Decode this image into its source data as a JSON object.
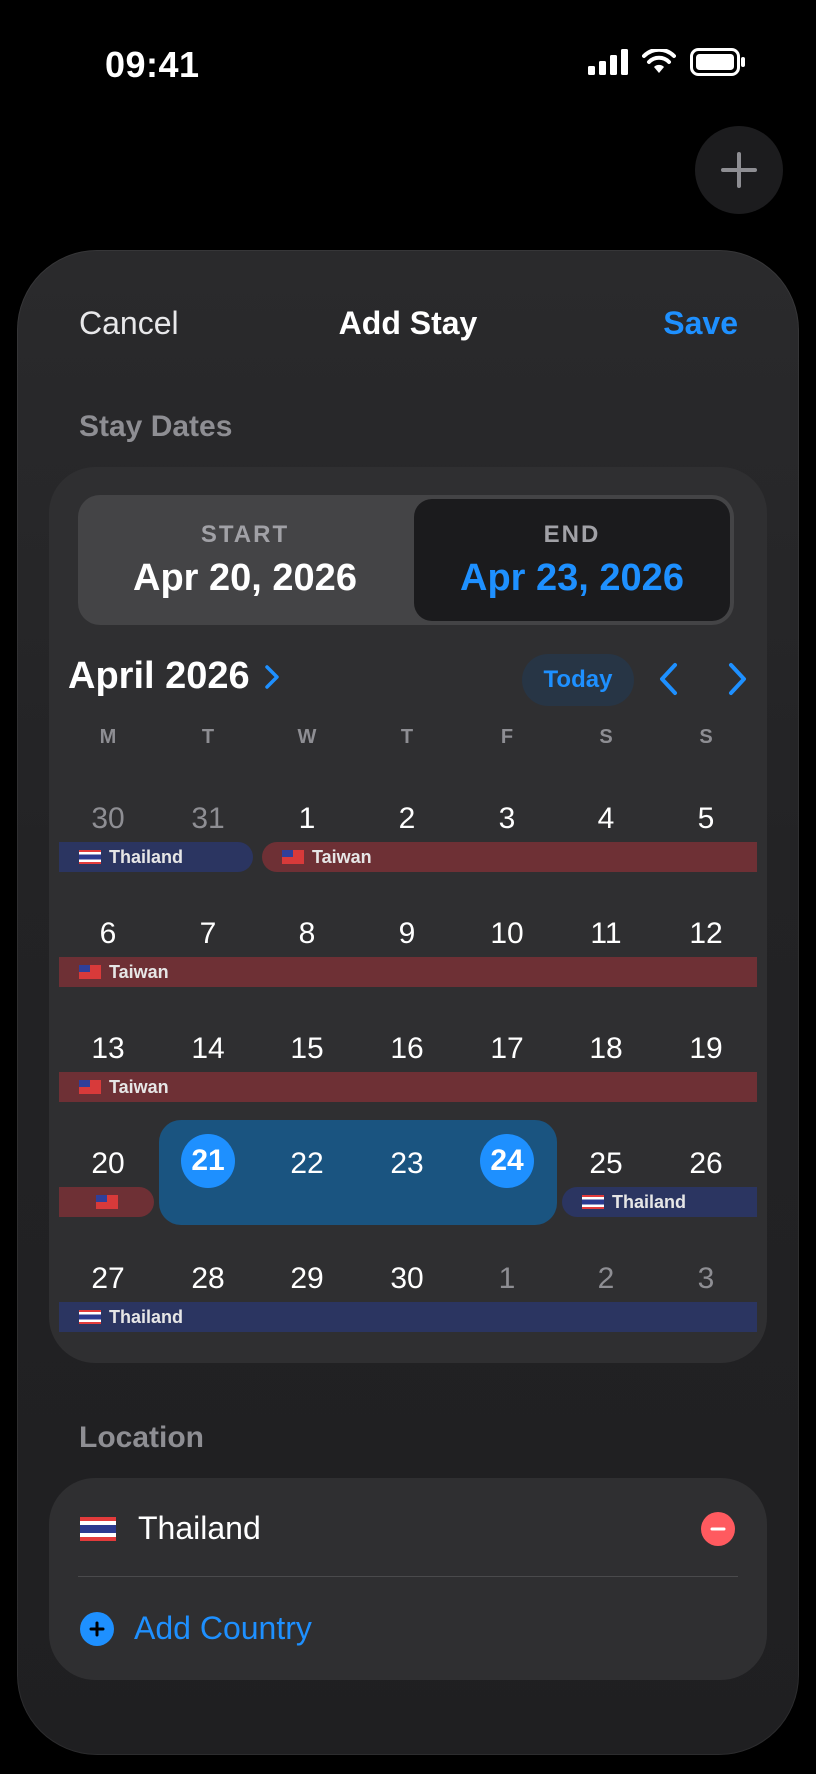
{
  "status": {
    "time": "09:41"
  },
  "nav": {
    "cancel": "Cancel",
    "title": "Add Stay",
    "save": "Save"
  },
  "stay_dates": {
    "label": "Stay Dates",
    "start_caption": "START",
    "start_value": "Apr 20, 2026",
    "end_caption": "END",
    "end_value": "Apr 23, 2026"
  },
  "calendar": {
    "month": "April 2026",
    "today": "Today",
    "weekdays": [
      "M",
      "T",
      "W",
      "T",
      "F",
      "S",
      "S"
    ],
    "weeks": [
      [
        "30",
        "31",
        "1",
        "2",
        "3",
        "4",
        "5"
      ],
      [
        "6",
        "7",
        "8",
        "9",
        "10",
        "11",
        "12"
      ],
      [
        "13",
        "14",
        "15",
        "16",
        "17",
        "18",
        "19"
      ],
      [
        "20",
        "21",
        "22",
        "23",
        "24",
        "25",
        "26"
      ],
      [
        "27",
        "28",
        "29",
        "30",
        "1",
        "2",
        "3"
      ]
    ],
    "stays": {
      "thailand": "Thailand",
      "taiwan": "Taiwan"
    }
  },
  "location": {
    "label": "Location",
    "country": "Thailand",
    "add": "Add Country"
  },
  "colors": {
    "accent": "#1e90ff",
    "taiwan_bar": "#6e3035",
    "thailand_bar": "#2b3561",
    "remove": "#ff5a5f"
  }
}
